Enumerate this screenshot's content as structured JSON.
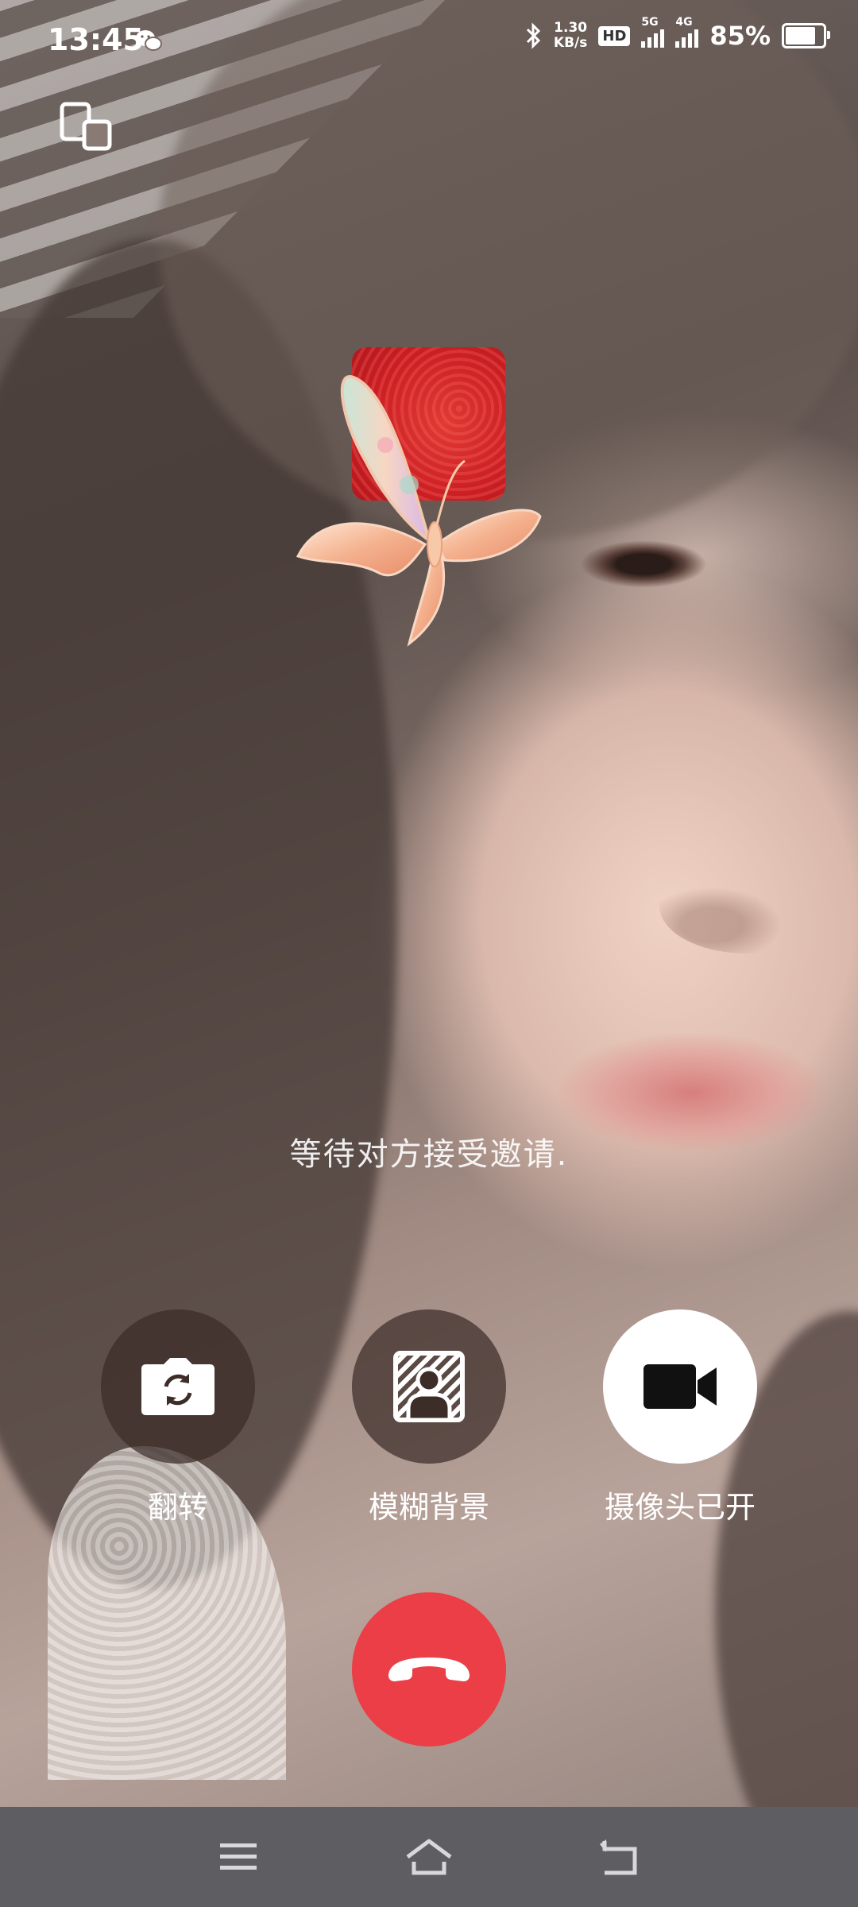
{
  "status_bar": {
    "time": "13:45",
    "network_speed_value": "1.30",
    "network_speed_unit": "KB/s",
    "hd_badge": "HD",
    "signal_1_label": "5G",
    "signal_2_label": "4G",
    "battery_percent": "85%",
    "battery_level": 0.85
  },
  "call": {
    "status_text": "等待对方接受邀请."
  },
  "controls": {
    "flip_label": "翻转",
    "blur_label": "模糊背景",
    "camera_label": "摄像头已开"
  },
  "colors": {
    "end_call": "#eb3e46",
    "control_dark": "#3c2d28",
    "control_white": "#ffffff",
    "navbar": "#5e5e62",
    "preview_bg": "#cc1f24"
  },
  "icons": {
    "chat": "wechat-icon",
    "switch_window": "switch-window-icon",
    "flip": "flip-camera-icon",
    "blur": "blur-background-icon",
    "camera": "video-camera-icon",
    "hangup": "hangup-icon",
    "menu": "menu-icon",
    "home": "home-icon",
    "back": "back-icon"
  }
}
